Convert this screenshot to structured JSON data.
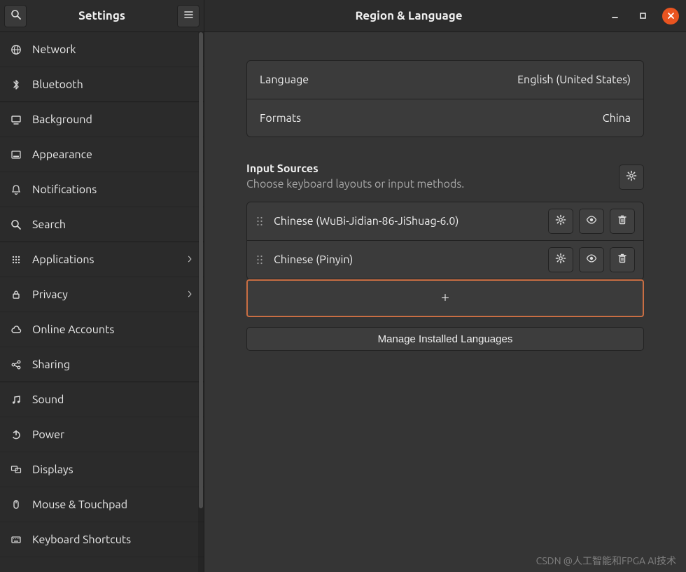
{
  "sidebar": {
    "title": "Settings",
    "items": [
      {
        "icon": "globe",
        "label": "Network",
        "chevron": false,
        "group_end": false
      },
      {
        "icon": "bluetooth",
        "label": "Bluetooth",
        "chevron": false,
        "group_end": true
      },
      {
        "icon": "desktop",
        "label": "Background",
        "chevron": false,
        "group_end": false
      },
      {
        "icon": "dock",
        "label": "Appearance",
        "chevron": false,
        "group_end": false
      },
      {
        "icon": "bell",
        "label": "Notifications",
        "chevron": false,
        "group_end": false
      },
      {
        "icon": "search",
        "label": "Search",
        "chevron": false,
        "group_end": true
      },
      {
        "icon": "grid",
        "label": "Applications",
        "chevron": true,
        "group_end": false
      },
      {
        "icon": "lock",
        "label": "Privacy",
        "chevron": true,
        "group_end": false
      },
      {
        "icon": "cloud",
        "label": "Online Accounts",
        "chevron": false,
        "group_end": false
      },
      {
        "icon": "share",
        "label": "Sharing",
        "chevron": false,
        "group_end": true
      },
      {
        "icon": "music",
        "label": "Sound",
        "chevron": false,
        "group_end": false
      },
      {
        "icon": "power",
        "label": "Power",
        "chevron": false,
        "group_end": false
      },
      {
        "icon": "displays",
        "label": "Displays",
        "chevron": false,
        "group_end": false
      },
      {
        "icon": "mouse",
        "label": "Mouse & Touchpad",
        "chevron": false,
        "group_end": false
      },
      {
        "icon": "keyboard",
        "label": "Keyboard Shortcuts",
        "chevron": false,
        "group_end": false
      }
    ]
  },
  "titlebar": {
    "title": "Region & Language"
  },
  "settings_rows": [
    {
      "key": "Language",
      "value": "English (United States)"
    },
    {
      "key": "Formats",
      "value": "China"
    }
  ],
  "input_sources": {
    "title": "Input Sources",
    "subtitle": "Choose keyboard layouts or input methods.",
    "items": [
      {
        "label": "Chinese (WuBi-Jidian-86-JiShuag-6.0)"
      },
      {
        "label": "Chinese (Pinyin)"
      }
    ],
    "add_label": "+",
    "manage_label": "Manage Installed Languages"
  },
  "watermark": "CSDN @人工智能和FPGA AI技术"
}
